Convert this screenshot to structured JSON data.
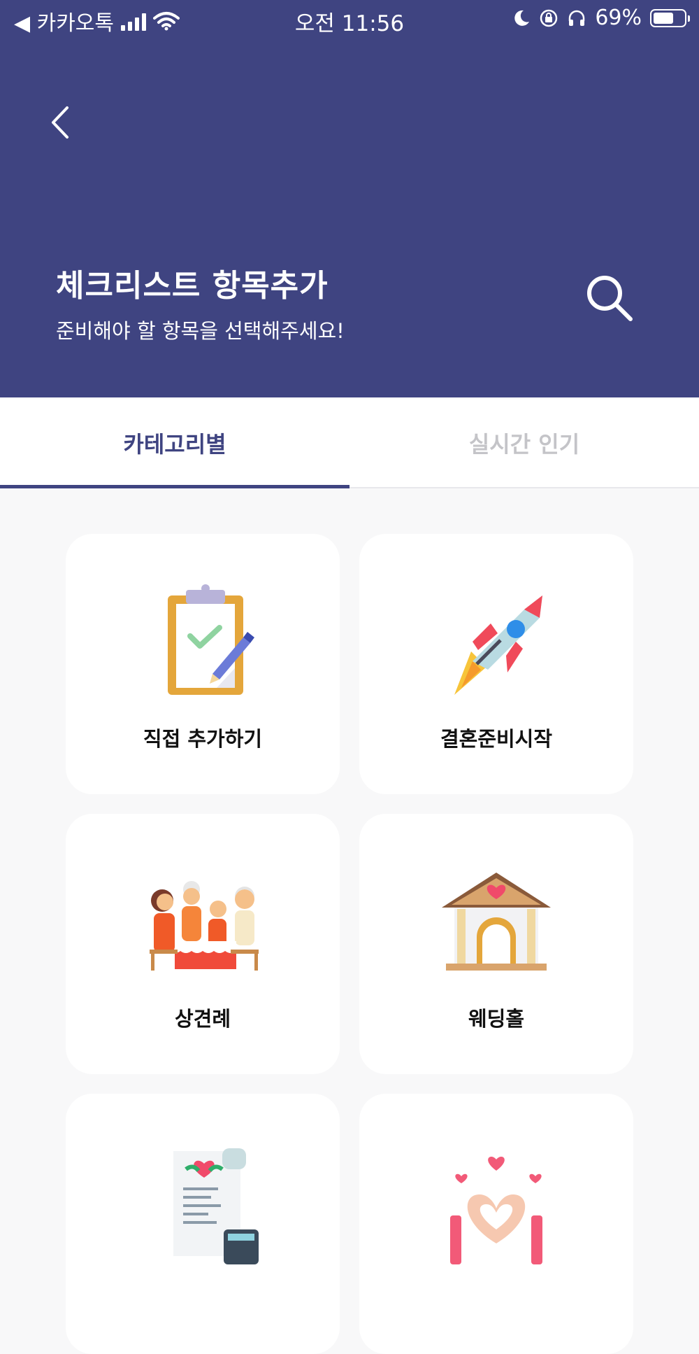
{
  "status_bar": {
    "back_app": "◀ 카카오톡",
    "time": "오전 11:56",
    "battery": "69%",
    "battery_level": 0.69
  },
  "header": {
    "title": "체크리스트 항목추가",
    "subtitle": "준비해야 할 항목을 선택해주세요!",
    "icons": {
      "back": "chevron-left-icon",
      "search": "search-icon"
    },
    "bg_color": "#3f4481"
  },
  "tabs": [
    {
      "label": "카테고리별",
      "active": true
    },
    {
      "label": "실시간 인기",
      "active": false
    }
  ],
  "categories": [
    {
      "label": "직접 추가하기",
      "icon": "clipboard-icon"
    },
    {
      "label": "결혼준비시작",
      "icon": "rocket-icon"
    },
    {
      "label": "상견례",
      "icon": "family-meeting-icon"
    },
    {
      "label": "웨딩홀",
      "icon": "wedding-hall-icon"
    },
    {
      "label": "",
      "icon": "receipt-calculator-icon"
    },
    {
      "label": "",
      "icon": "heart-hands-icon"
    }
  ],
  "colors": {
    "accent": "#3f4481",
    "inactive_tab": "#c4c4c8",
    "background": "#f8f8f9"
  }
}
